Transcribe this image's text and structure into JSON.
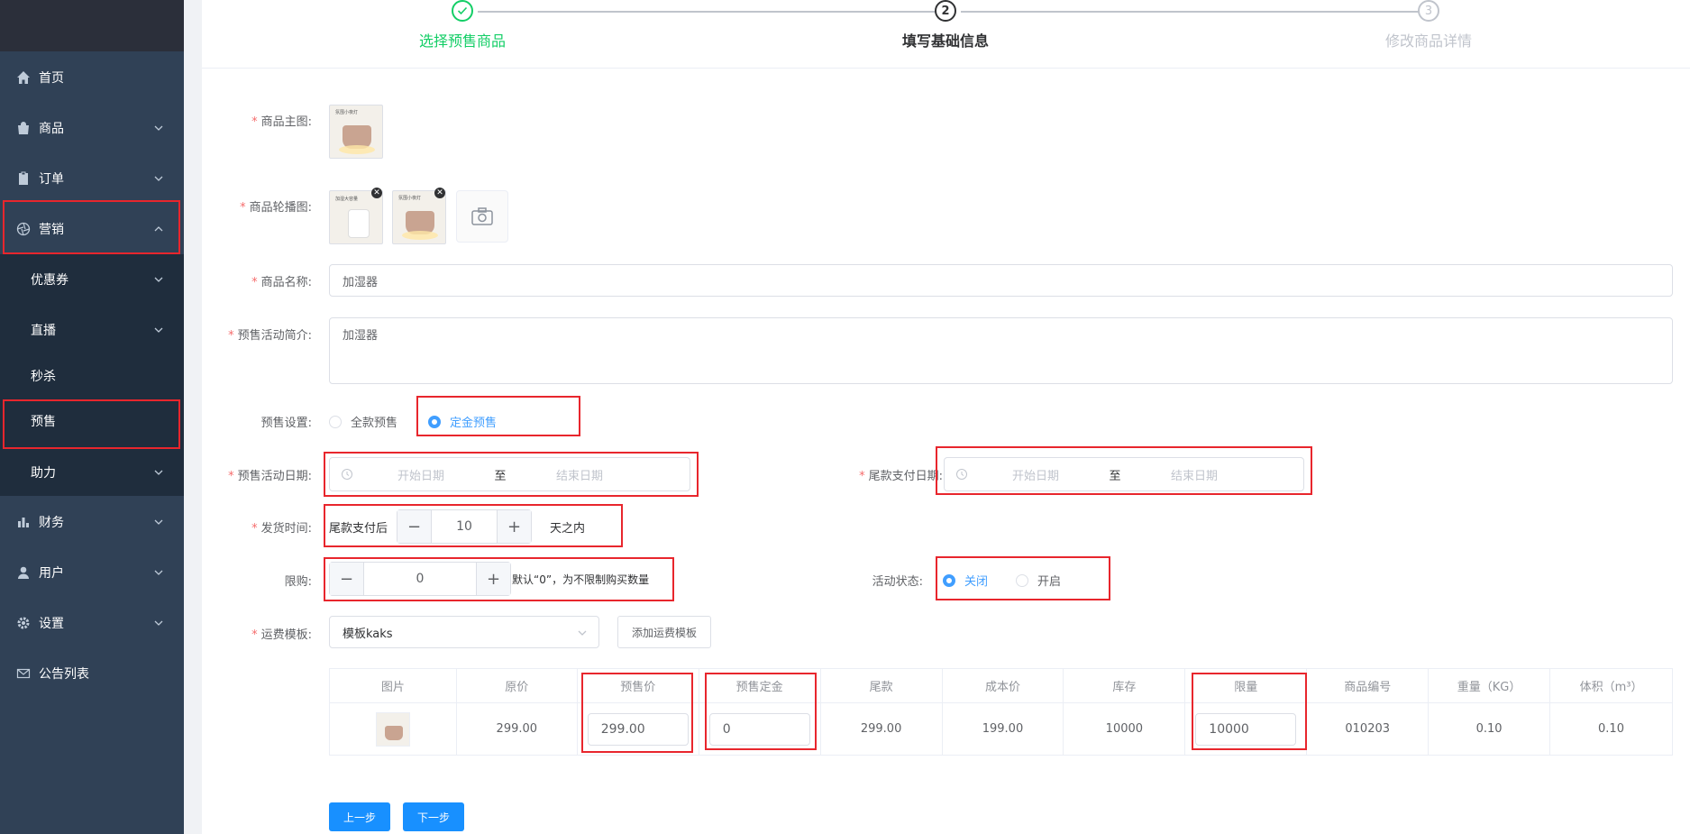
{
  "sidebar": {
    "items": [
      {
        "label": "首页",
        "icon": "home-icon"
      },
      {
        "label": "商品",
        "icon": "bag-icon"
      },
      {
        "label": "订单",
        "icon": "clipboard-icon"
      },
      {
        "label": "营销",
        "icon": "aperture-icon"
      },
      {
        "label": "优惠券"
      },
      {
        "label": "直播"
      },
      {
        "label": "秒杀"
      },
      {
        "label": "预售"
      },
      {
        "label": "助力"
      },
      {
        "label": "财务",
        "icon": "bar-chart-icon"
      },
      {
        "label": "用户",
        "icon": "user-icon"
      },
      {
        "label": "设置",
        "icon": "gear-icon"
      },
      {
        "label": "公告列表",
        "icon": "mail-icon"
      }
    ]
  },
  "steps": [
    {
      "num": "✓",
      "title": "选择预售商品"
    },
    {
      "num": "2",
      "title": "填写基础信息"
    },
    {
      "num": "3",
      "title": "修改商品详情"
    }
  ],
  "form": {
    "main_image_label": "商品主图:",
    "carousel_label": "商品轮播图:",
    "name_label": "商品名称:",
    "name_value": "加湿器",
    "intro_label": "预售活动简介:",
    "intro_value": "加湿器",
    "presale_label": "预售设置:",
    "presale_options": [
      "全款预售",
      "定金预售"
    ],
    "activity_date_label": "预售活动日期:",
    "final_pay_date_label": "尾款支付日期:",
    "start_placeholder": "开始日期",
    "end_placeholder": "结束日期",
    "range_sep": "至",
    "ship_label": "发货时间:",
    "ship_prefix": "尾款支付后",
    "ship_value": "10",
    "ship_suffix": "天之内",
    "limit_label": "限购:",
    "limit_value": "0",
    "limit_hint": "默认“0”，为不限制购买数量",
    "status_label": "活动状态:",
    "status_options": [
      "关闭",
      "开启"
    ],
    "freight_label": "运费模板:",
    "freight_value": "模板kaks",
    "freight_add": "添加运费模板"
  },
  "table": {
    "headers": [
      "图片",
      "原价",
      "预售价",
      "预售定金",
      "尾款",
      "成本价",
      "库存",
      "限量",
      "商品编号",
      "重量（KG）",
      "体积（m³）"
    ],
    "row": [
      "",
      "299.00",
      "299.00",
      "0",
      "299.00",
      "199.00",
      "10000",
      "10000",
      "010203",
      "0.10",
      "0.10"
    ]
  },
  "buttons": {
    "prev": "上一步",
    "next": "下一步"
  },
  "thumb_texts": {
    "lamp": "氛围小夜灯",
    "humid": "加湿大容量"
  },
  "colors": {
    "sidebar_bg": "#304156",
    "submenu_bg": "#1f2d3d",
    "primary": "#409eff",
    "success": "#13ce66",
    "highlight_box": "#e8262d",
    "required": "#f56c6c"
  }
}
